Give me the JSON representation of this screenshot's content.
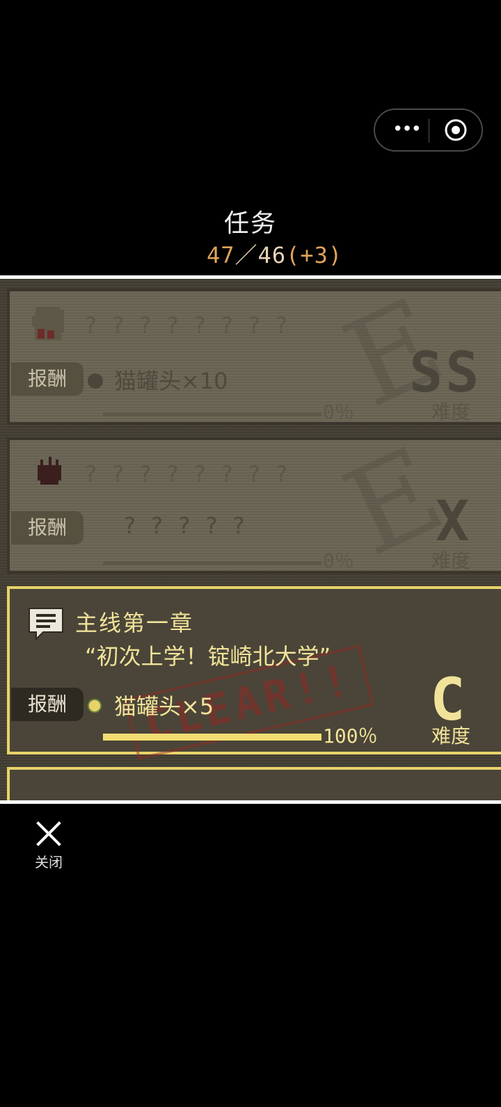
{
  "header": {
    "title": "任务",
    "counter_done": "47",
    "counter_sep": "／",
    "counter_total": "46",
    "counter_bonus": "(+3)"
  },
  "capsule": {
    "more_icon": "more-icon",
    "close_icon": "target-icon",
    "dots": "•••"
  },
  "tasks": [
    {
      "name": "? ? ? ? ? ? ? ?",
      "reward_label": "报酬",
      "reward_text": "猫罐头×10",
      "progress": "0％",
      "progress_value": 0,
      "grade": "SS",
      "difficulty_label": "难度",
      "watermark": "E",
      "locked": true
    },
    {
      "name": "? ? ? ? ? ? ? ?",
      "reward_label": "报酬",
      "reward_text": "? ? ? ? ?",
      "progress": "0％",
      "progress_value": 0,
      "grade": "X",
      "difficulty_label": "难度",
      "watermark": "E",
      "locked": true
    },
    {
      "name": "主线第一章",
      "subname": "“初次上学！锭崎北大学”",
      "reward_label": "报酬",
      "reward_text": "猫罐头×5",
      "progress": "100％",
      "progress_value": 1.0,
      "grade": "C",
      "difficulty_label": "难度",
      "stamp": "CLEAR!!",
      "locked": false
    }
  ],
  "footer": {
    "close_label": "关闭"
  },
  "colors": {
    "accent": "#f1e39a",
    "counter": "#e0a35a",
    "progress_fill": "#f3dd73"
  }
}
